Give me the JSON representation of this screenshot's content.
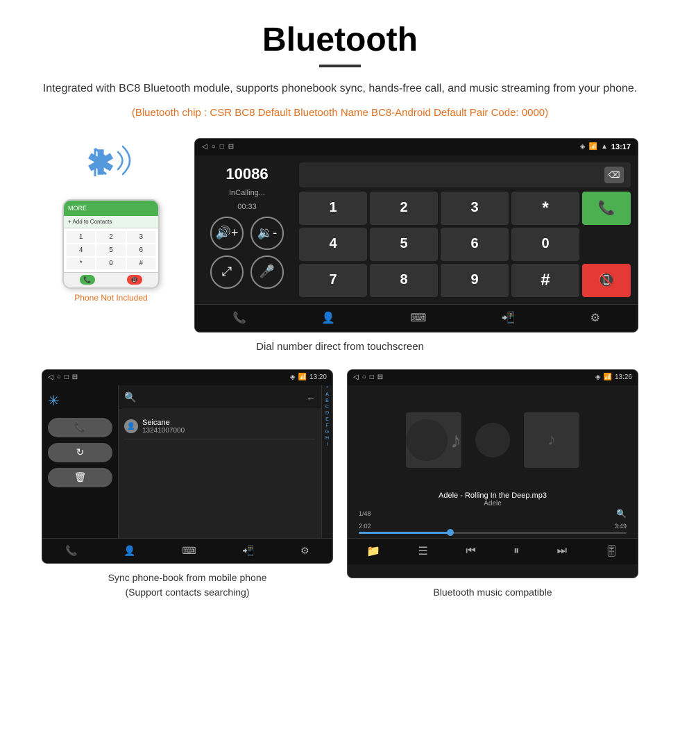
{
  "header": {
    "title": "Bluetooth",
    "description": "Integrated with BC8 Bluetooth module, supports phonebook sync, hands-free call, and music streaming from your phone.",
    "orange_note": "(Bluetooth chip : CSR BC8    Default Bluetooth Name BC8-Android    Default Pair Code: 0000)"
  },
  "phone": {
    "not_included": "Phone Not Included",
    "contact_label": "+ Add to Contacts",
    "keys": [
      "1",
      "2",
      "3",
      "4",
      "5",
      "6",
      "*",
      "0",
      "#"
    ]
  },
  "dial_screen": {
    "time": "13:17",
    "number": "10086",
    "status": "InCalling...",
    "timer": "00:33",
    "keypad": [
      "1",
      "2",
      "3",
      "*",
      "",
      "4",
      "5",
      "6",
      "0",
      "",
      "7",
      "8",
      "9",
      "#",
      ""
    ]
  },
  "dial_caption": "Dial number direct from touchscreen",
  "phonebook_screen": {
    "time": "13:20",
    "contact_name": "Seicane",
    "contact_phone": "13241007000",
    "alphabet": [
      "A",
      "B",
      "C",
      "D",
      "E",
      "F",
      "G",
      "H",
      "I"
    ]
  },
  "music_screen": {
    "time": "13:26",
    "song_title": "Adele - Rolling In the Deep.mp3",
    "artist": "Adele",
    "track_info": "1/48",
    "current_time": "2:02",
    "total_time": "3:49"
  },
  "phonebook_caption": "Sync phone-book from mobile phone\n(Support contacts searching)",
  "music_caption": "Bluetooth music compatible"
}
